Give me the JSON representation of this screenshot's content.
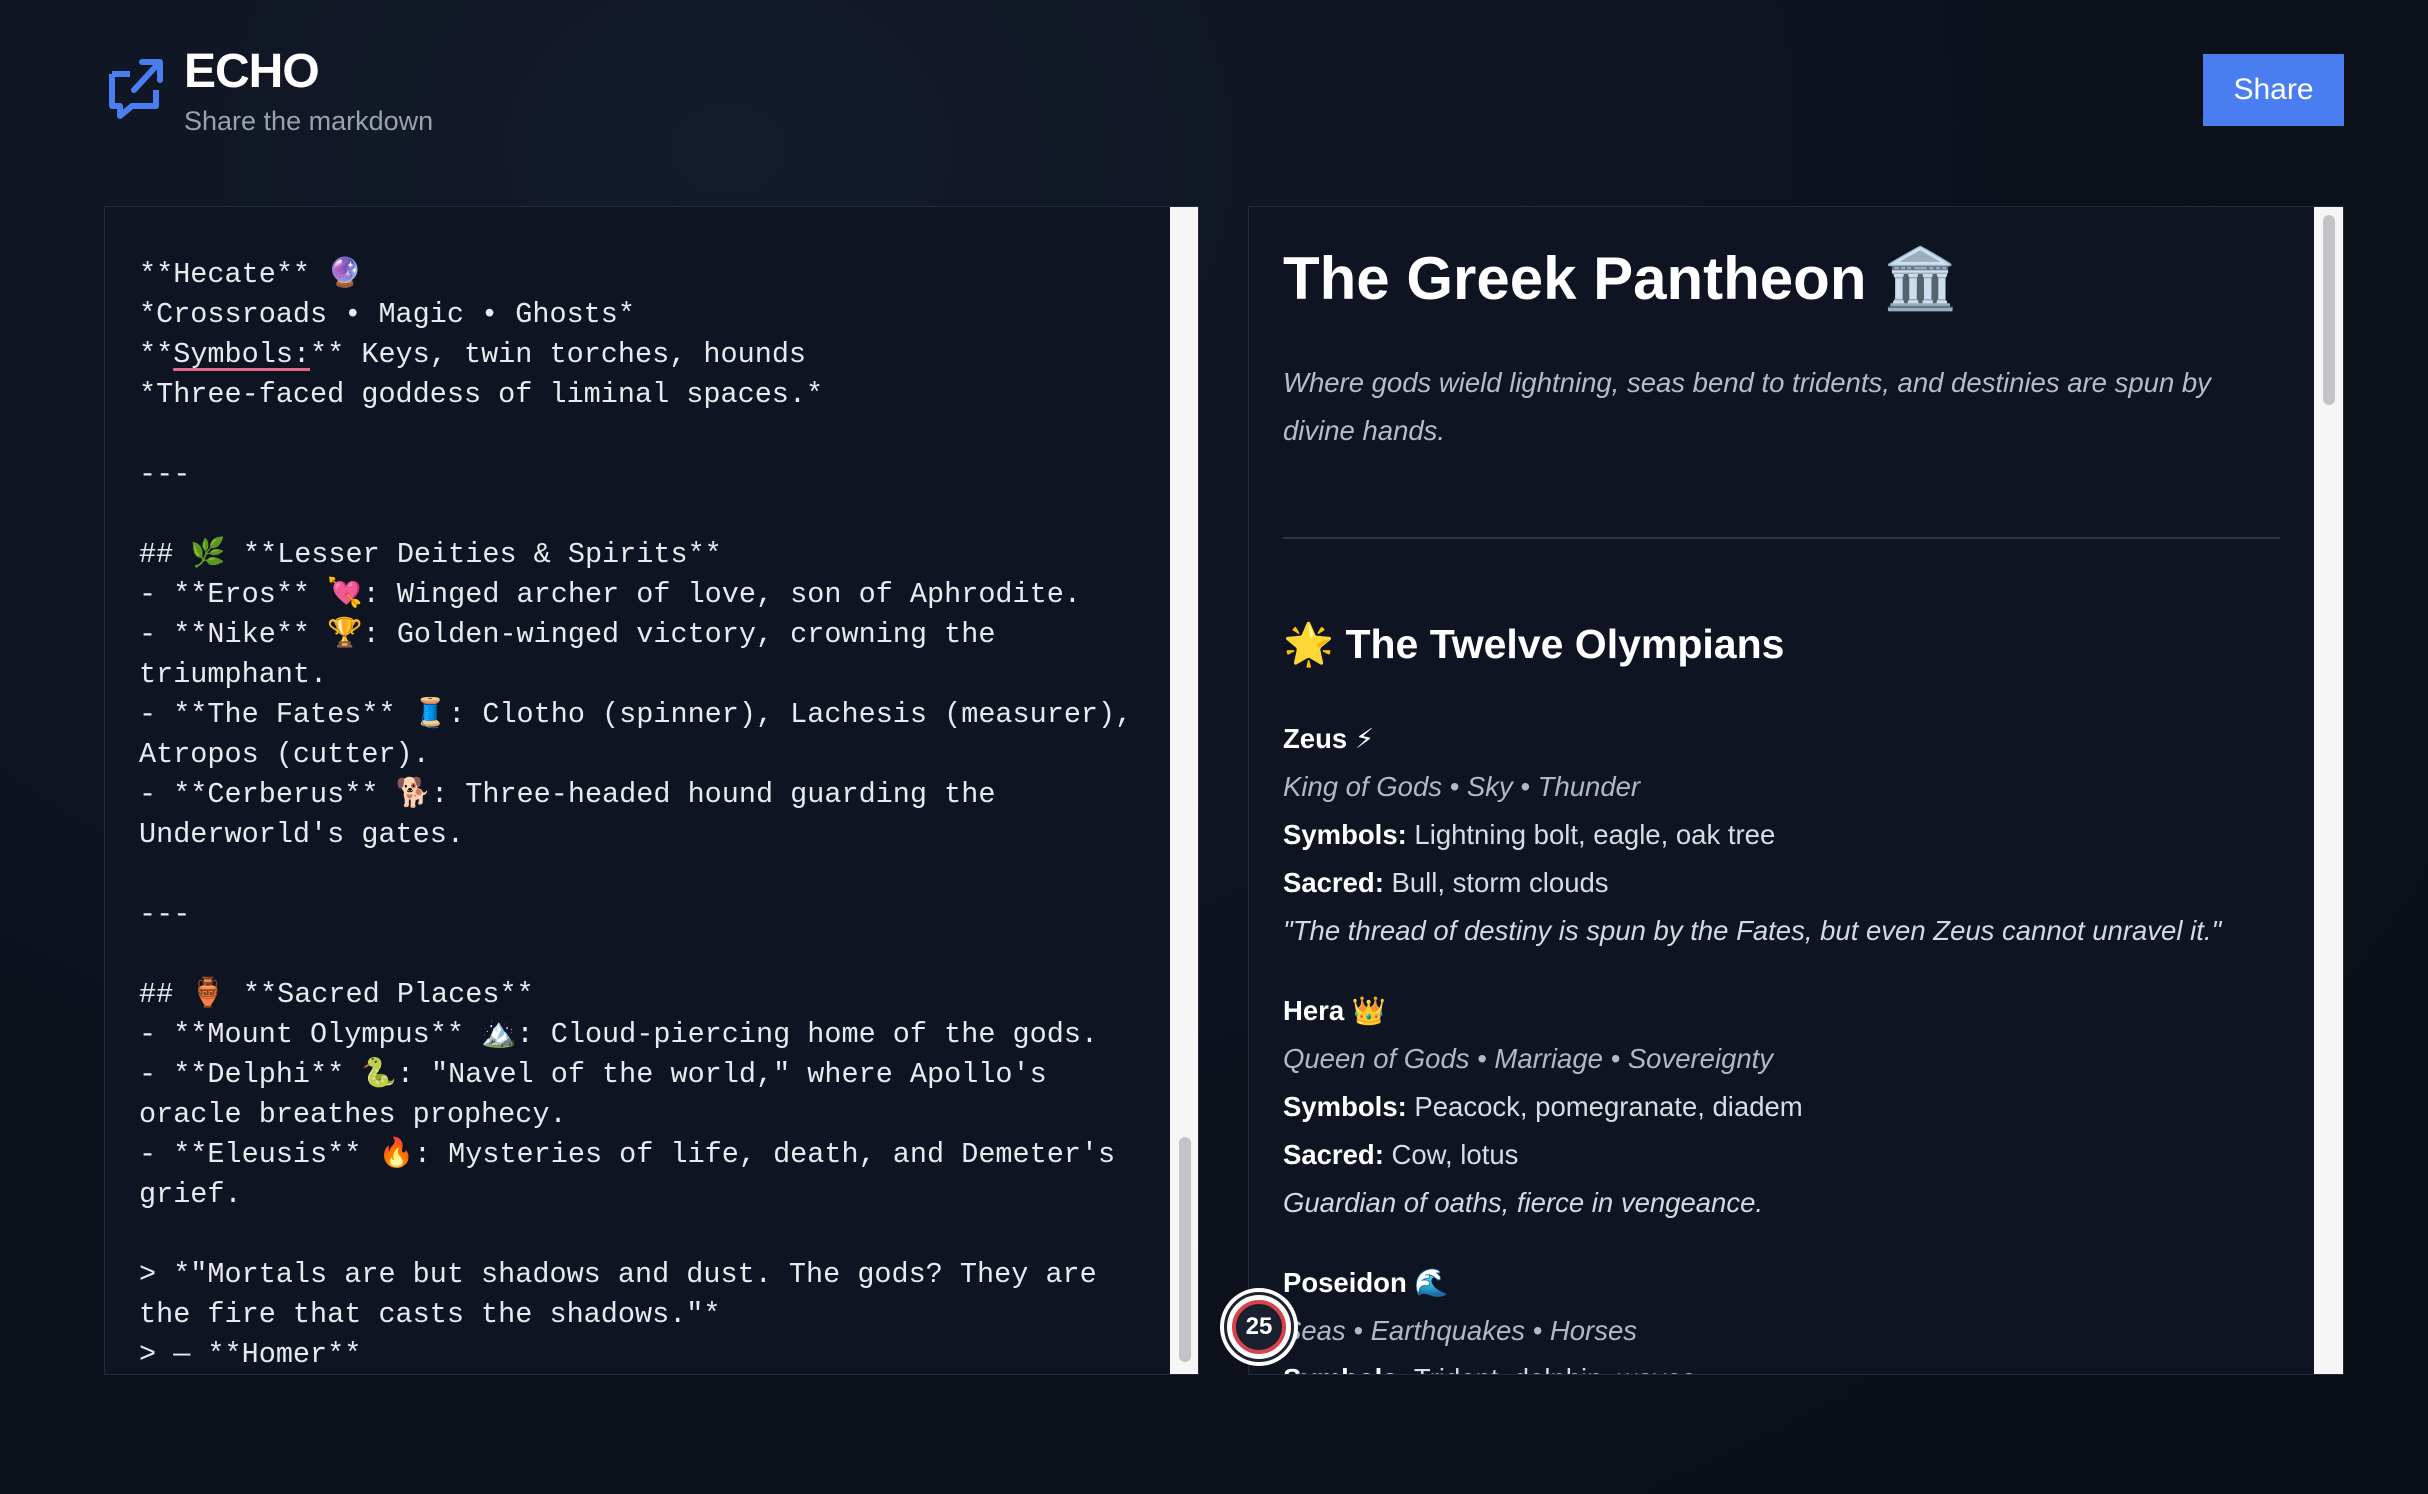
{
  "header": {
    "title": "ECHO",
    "subtitle": "Share the markdown",
    "share_label": "Share",
    "accent": "#4a7ef0"
  },
  "editor": {
    "lines": [
      "**Hecate** 🔮",
      "*Crossroads • Magic • Ghosts*",
      "**Symbols:** Keys, twin torches, hounds",
      "*Three-faced goddess of liminal spaces.*",
      "",
      "---",
      "",
      "## 🌿 **Lesser Deities & Spirits**",
      "- **Eros** 💘: Winged archer of love, son of Aphrodite.",
      "- **Nike** 🏆: Golden-winged victory, crowning the",
      "triumphant.",
      "- **The Fates** 🧵: Clotho (spinner), Lachesis (measurer),",
      "Atropos (cutter).",
      "- **Cerberus** 🐕: Three-headed hound guarding the",
      "Underworld's gates.",
      "",
      "---",
      "",
      "## 🏺 **Sacred Places**",
      "- **Mount Olympus** 🏔️: Cloud-piercing home of the gods.",
      "- **Delphi** 🐍: \"Navel of the world,\" where Apollo's",
      "oracle breathes prophecy.",
      "- **Eleusis** 🔥: Mysteries of life, death, and Demeter's",
      "grief.",
      "",
      "> *\"Mortals are but shadows and dust. The gods? They are",
      "the fire that casts the shadows.\"*",
      "> — **Homer**"
    ]
  },
  "preview": {
    "title": "The Greek Pantheon 🏛️",
    "intro": "Where gods wield lightning, seas bend to tridents, and destinies are spun by divine hands.",
    "section_title": "🌟 The Twelve Olympians",
    "gods": [
      {
        "name": "Zeus ⚡",
        "domain": "King of Gods • Sky • Thunder",
        "symbols_label": "Symbols:",
        "symbols": " Lightning bolt, eagle, oak tree",
        "sacred_label": "Sacred:",
        "sacred": " Bull, storm clouds",
        "note": "\"The thread of destiny is spun by the Fates, but even Zeus cannot unravel it.\""
      },
      {
        "name": "Hera 👑",
        "domain": "Queen of Gods • Marriage • Sovereignty",
        "symbols_label": "Symbols:",
        "symbols": " Peacock, pomegranate, diadem",
        "sacred_label": "Sacred:",
        "sacred": " Cow, lotus",
        "note": "Guardian of oaths, fierce in vengeance."
      },
      {
        "name": "Poseidon 🌊",
        "domain": "Seas • Earthquakes • Horses",
        "symbols_label": "Symbols:",
        "symbols": " Trident, dolphin, waves"
      }
    ]
  },
  "badge": {
    "count": "25"
  }
}
